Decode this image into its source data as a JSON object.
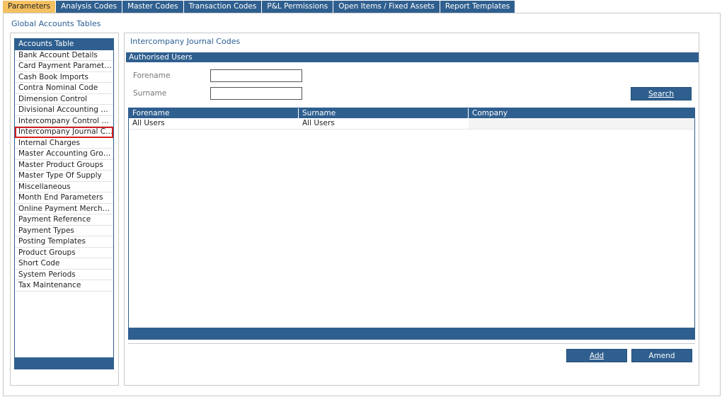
{
  "tabs": [
    {
      "label": "Parameters",
      "active": true
    },
    {
      "label": "Analysis Codes",
      "active": false
    },
    {
      "label": "Master Codes",
      "active": false
    },
    {
      "label": "Transaction Codes",
      "active": false
    },
    {
      "label": "P&L Permissions",
      "active": false
    },
    {
      "label": "Open Items / Fixed Assets",
      "active": false
    },
    {
      "label": "Report Templates",
      "active": false
    }
  ],
  "section_title": "Global Accounts Tables",
  "list": {
    "header": "Accounts Table",
    "items": [
      "Bank Account Details",
      "Card Payment Parameters",
      "Cash Book Imports",
      "Contra Nominal Code",
      "Dimension Control",
      "Divisional Accounting Gro...",
      "Intercompany Control Co...",
      "Intercompany Journal Co...",
      "Internal Charges",
      "Master Accounting Groups",
      "Master Product Groups",
      "Master Type Of Supply",
      "Miscellaneous",
      "Month End Parameters",
      "Online Payment Merchants",
      "Payment Reference",
      "Payment Types",
      "Posting Templates",
      "Product Groups",
      "Short Code",
      "System Periods",
      "Tax Maintenance"
    ],
    "selected_index": 7
  },
  "main": {
    "title": "Intercompany Journal Codes",
    "subheader": "Authorised Users",
    "forename_label": "Forename",
    "surname_label": "Surname",
    "forename_value": "",
    "surname_value": "",
    "search_label": "Search",
    "grid": {
      "columns": [
        "Forename",
        "Surname",
        "Company"
      ],
      "rows": [
        [
          "All Users",
          "All Users",
          ""
        ]
      ]
    },
    "add_label": "Add",
    "amend_label": "Amend"
  },
  "colors": {
    "accent": "#2f5f8f",
    "active_tab": "#f4c060",
    "highlight": "#d62020"
  }
}
